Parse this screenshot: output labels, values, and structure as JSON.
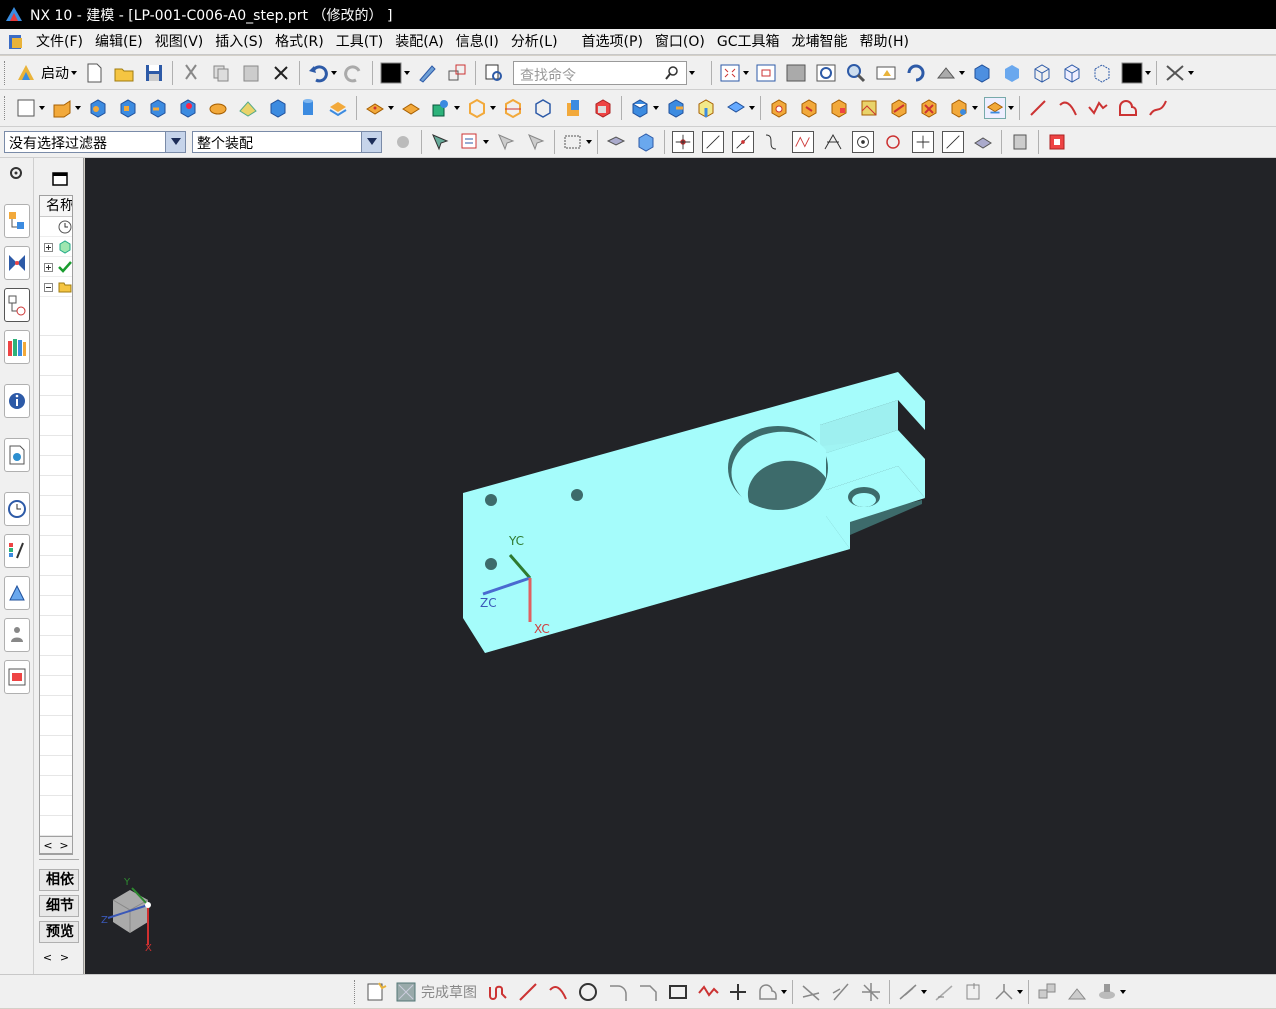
{
  "title": "NX 10 - 建模 - [LP-001-C006-A0_step.prt （修改的） ]",
  "menu": [
    "文件(F)",
    "编辑(E)",
    "视图(V)",
    "插入(S)",
    "格式(R)",
    "工具(T)",
    "装配(A)",
    "信息(I)",
    "分析(L)",
    "首选项(P)",
    "窗口(O)",
    "GC工具箱",
    "龙埔智能",
    "帮助(H)"
  ],
  "toolbar1": {
    "start_label": "启动",
    "search_placeholder": "查找命令"
  },
  "toolbar3": {
    "filter_value": "没有选择过滤器",
    "scope_value": "整个装配"
  },
  "navigator": {
    "col_header": "名称",
    "bottom_tabs": [
      "相依",
      "细节",
      "预览"
    ]
  },
  "status": {
    "finish_sketch": "完成草图"
  },
  "triad": {
    "yc": "YC",
    "zc": "ZC",
    "xc": "XC"
  },
  "viewtriad": {
    "y": "Y",
    "z": "Z",
    "x": "X"
  },
  "colors": {
    "part_top": "#a5fcfb",
    "part_side": "#3d6b6b",
    "viewport_bg": "#222327",
    "titlebar": "#000000"
  }
}
